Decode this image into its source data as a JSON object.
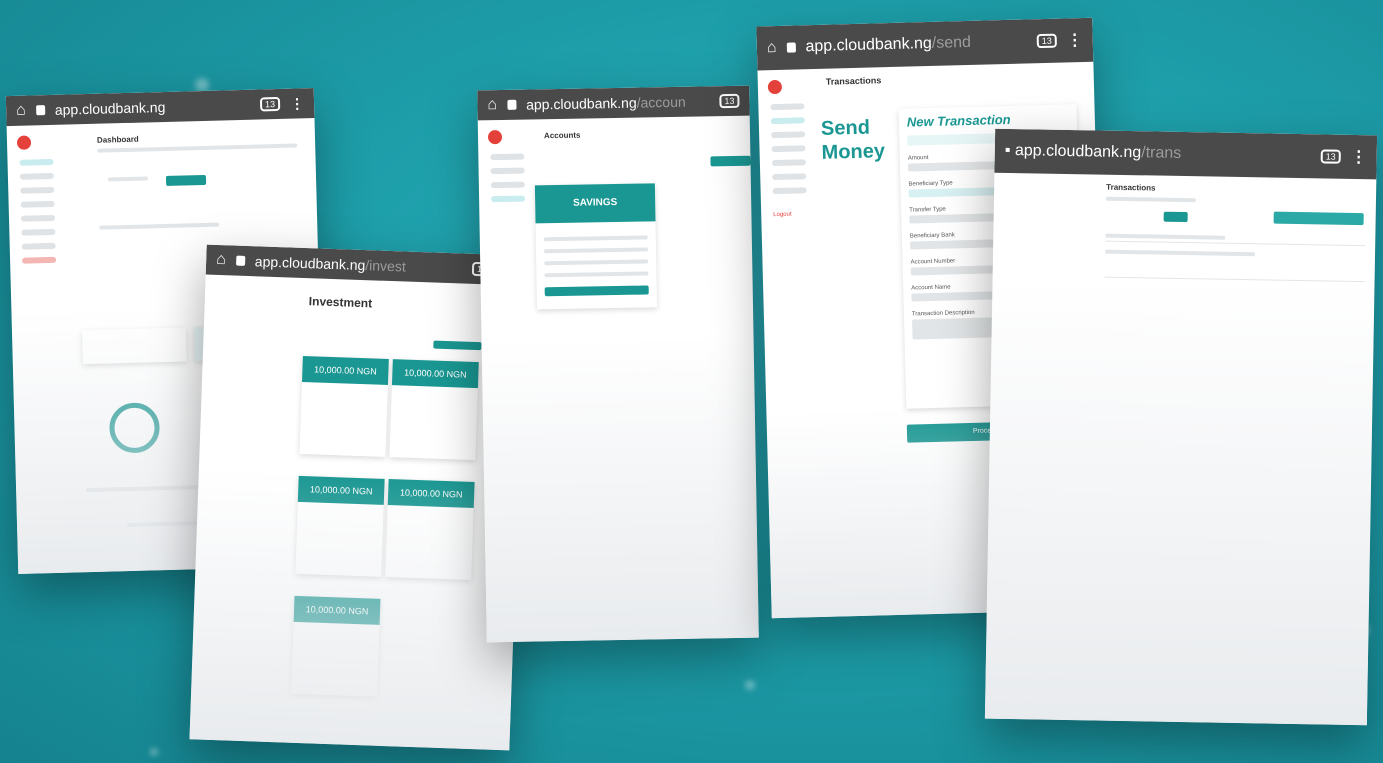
{
  "bar": {
    "tabs_count": "13"
  },
  "screens": {
    "dashboard": {
      "url": "app.cloudbank.ng",
      "title": "Dashboard"
    },
    "investment": {
      "url_host": "app.cloudbank.ng",
      "url_path": "/invest",
      "title": "Investment",
      "plans": [
        "10,000.00",
        "10,000.00",
        "10,000.00",
        "10,000.00",
        "10,000.00"
      ],
      "plan_unit": "NGN"
    },
    "accounts": {
      "url_host": "app.cloudbank.ng",
      "url_path": "/accoun",
      "title": "Accounts",
      "card_title": "SAVINGS"
    },
    "send": {
      "url_host": "app.cloudbank.ng",
      "url_path": "/send",
      "title": "Transactions",
      "hero": "Send Money",
      "form_title": "New Transaction",
      "fields": [
        "Amount",
        "Beneficiary Type",
        "Transfer Type",
        "Beneficiary Bank",
        "Account Number",
        "Account Name",
        "Transaction Description"
      ],
      "submit": "Proceed",
      "logout": "Logout"
    },
    "trans": {
      "url_host": "app.cloudbank.ng",
      "url_path": "/trans",
      "title": "Transactions"
    }
  },
  "colors": {
    "accent": "#1a9792",
    "brand": "#e5413b",
    "background": "#1d9ea9"
  }
}
